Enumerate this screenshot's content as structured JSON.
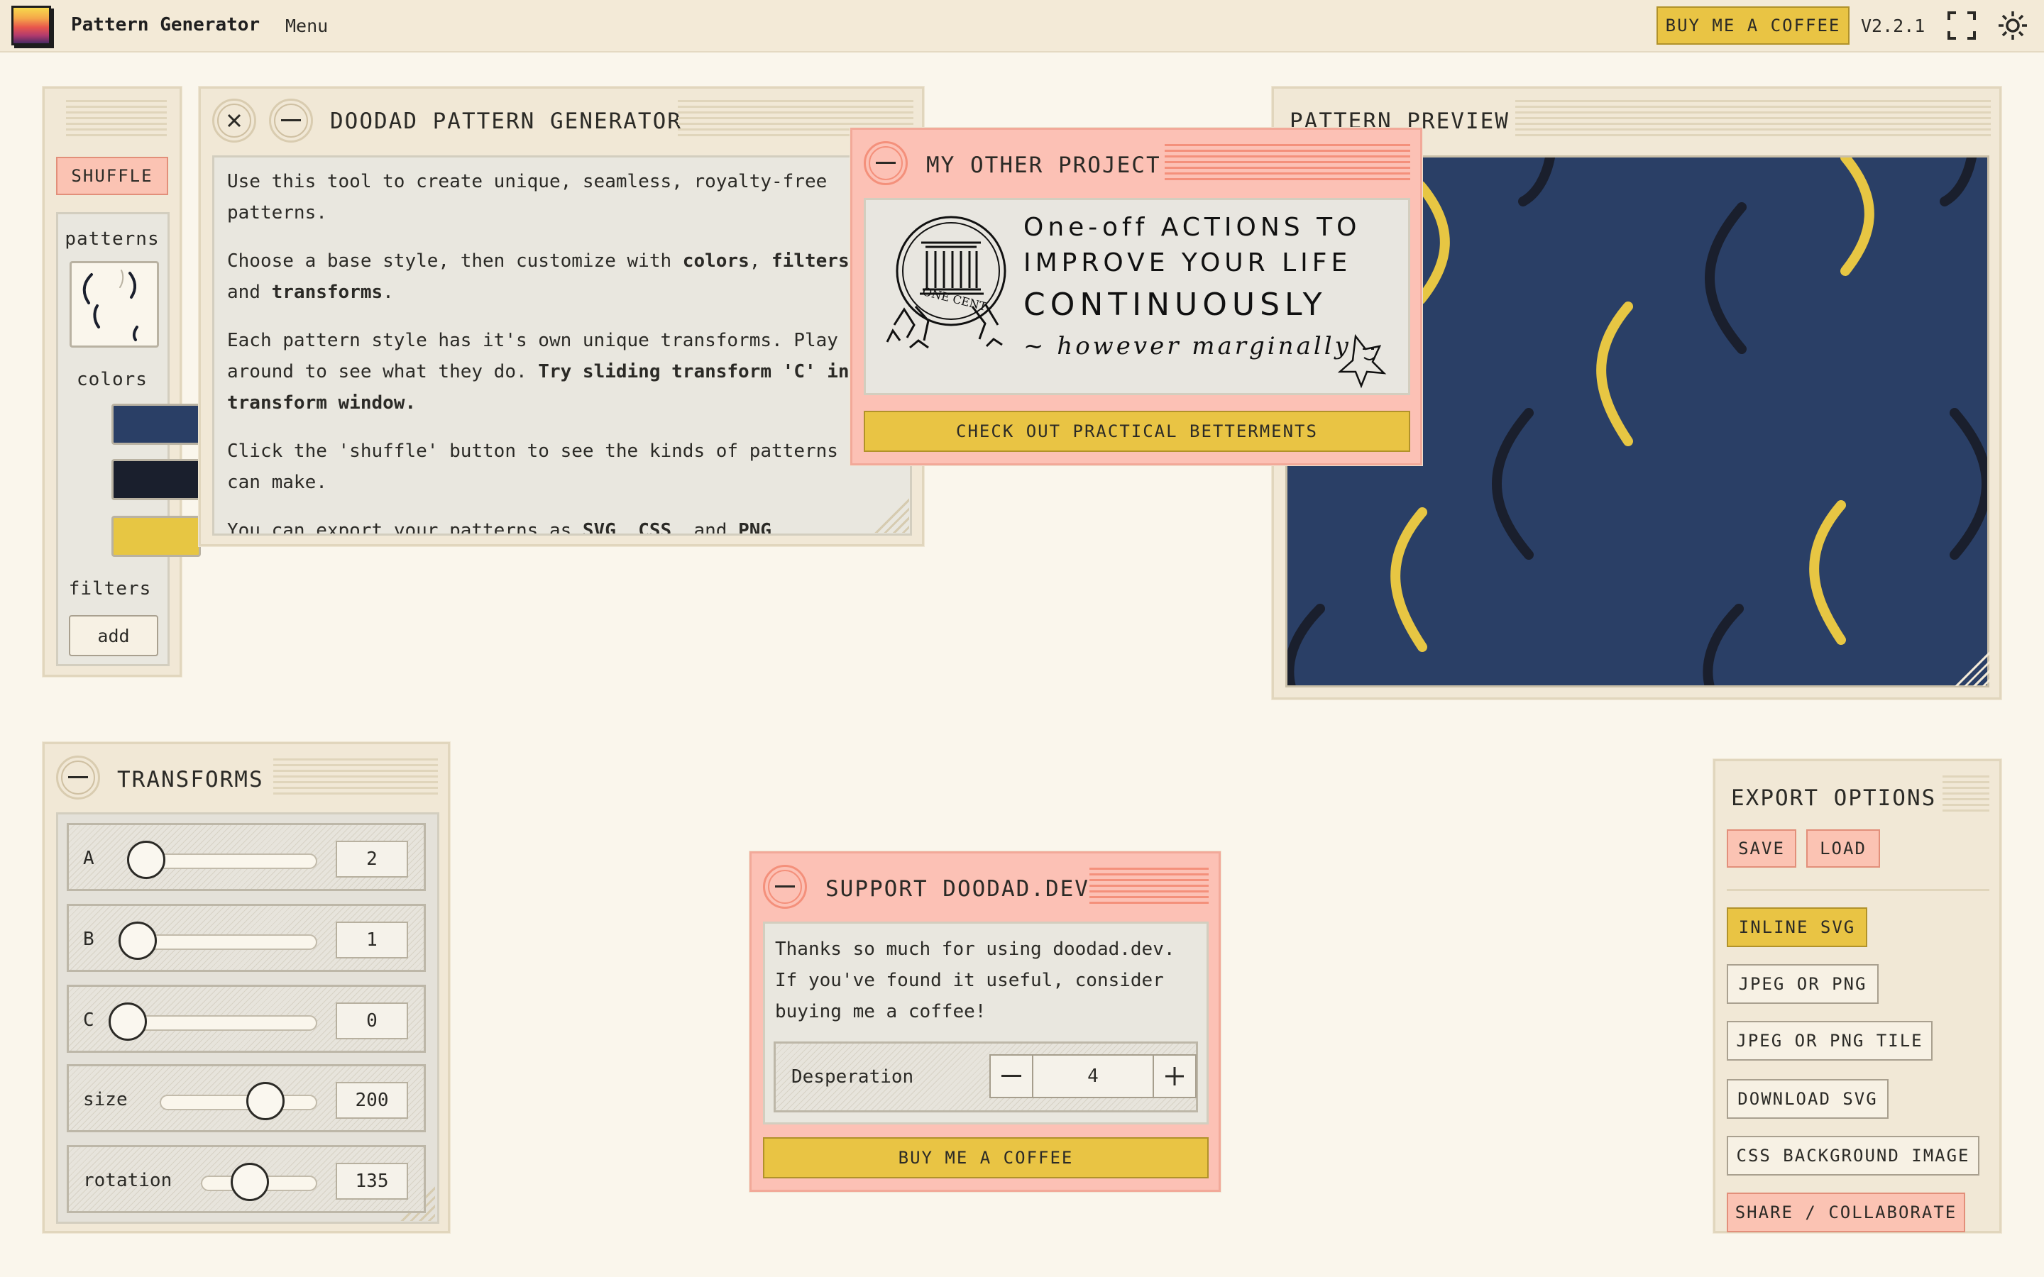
{
  "header": {
    "app_title": "Pattern Generator",
    "menu_label": "Menu",
    "coffee_label": "BUY ME A COFFEE",
    "version": "V2.2.1",
    "icons": [
      "logo-icon",
      "fullscreen-icon",
      "sun-icon"
    ]
  },
  "sidebar": {
    "shuffle_label": "SHUFFLE",
    "patterns_label": "patterns",
    "colors_label": "colors",
    "colors": [
      "#2a3f66",
      "#1a1f2d",
      "#e7c643"
    ],
    "filters_label": "filters",
    "add_label": "add"
  },
  "doodad_window": {
    "title": "DOODAD PATTERN GENERATOR",
    "p1": "Use this tool to create unique, seamless, royalty-free patterns.",
    "p2_a": "Choose a base style, then customize with ",
    "p2_b": "colors",
    "p2_c": ", ",
    "p2_d": "filters",
    "p2_e": ", and ",
    "p2_f": "transforms",
    "p2_g": ".",
    "p3_a": "Each pattern style has it's own unique transforms. Play around to see what they do. ",
    "p3_b": "Try sliding transform 'C' in the transform window.",
    "p4": "Click the 'shuffle' button to see the kinds of patterns you can make.",
    "p5_a": "You can export your patterns as ",
    "p5_b": "SVG",
    "p5_c": ", ",
    "p5_d": "CSS",
    "p5_e": ", and ",
    "p5_f": "PNG",
    "p5_g": "."
  },
  "project_window": {
    "title": "MY OTHER PROJECT",
    "art_line1": "One-off ACTIONS TO",
    "art_line2": "IMPROVE YOUR LIFE",
    "art_line3": "CONTINUOUSLY",
    "art_line4": "~ however marginally",
    "coin_text": "ONE CENT",
    "cta_label": "CHECK OUT PRACTICAL BETTERMENTS"
  },
  "preview_window": {
    "title": "PATTERN PREVIEW",
    "bg_color": "#2a3f66",
    "dark_color": "#1a1f2d",
    "accent_color": "#e7c643"
  },
  "transforms_window": {
    "title": "TRANSFORMS",
    "rows": [
      {
        "label": "A",
        "value": "2"
      },
      {
        "label": "B",
        "value": "1"
      },
      {
        "label": "C",
        "value": "0"
      },
      {
        "label": "size",
        "value": "200"
      },
      {
        "label": "rotation",
        "value": "135"
      }
    ]
  },
  "support_window": {
    "title": "SUPPORT DOODAD.DEV",
    "text": "Thanks so much for using doodad.dev. If you've found it useful, consider buying me a coffee!",
    "desperation_label": "Desperation",
    "desperation_value": "4",
    "coffee_label": "BUY ME A COFFEE"
  },
  "export_window": {
    "title": "EXPORT OPTIONS",
    "save_label": "SAVE",
    "load_label": "LOAD",
    "options": [
      "INLINE SVG",
      "JPEG OR PNG",
      "JPEG OR PNG TILE",
      "DOWNLOAD SVG",
      "CSS BACKGROUND IMAGE",
      "SHARE / COLLABORATE"
    ]
  }
}
